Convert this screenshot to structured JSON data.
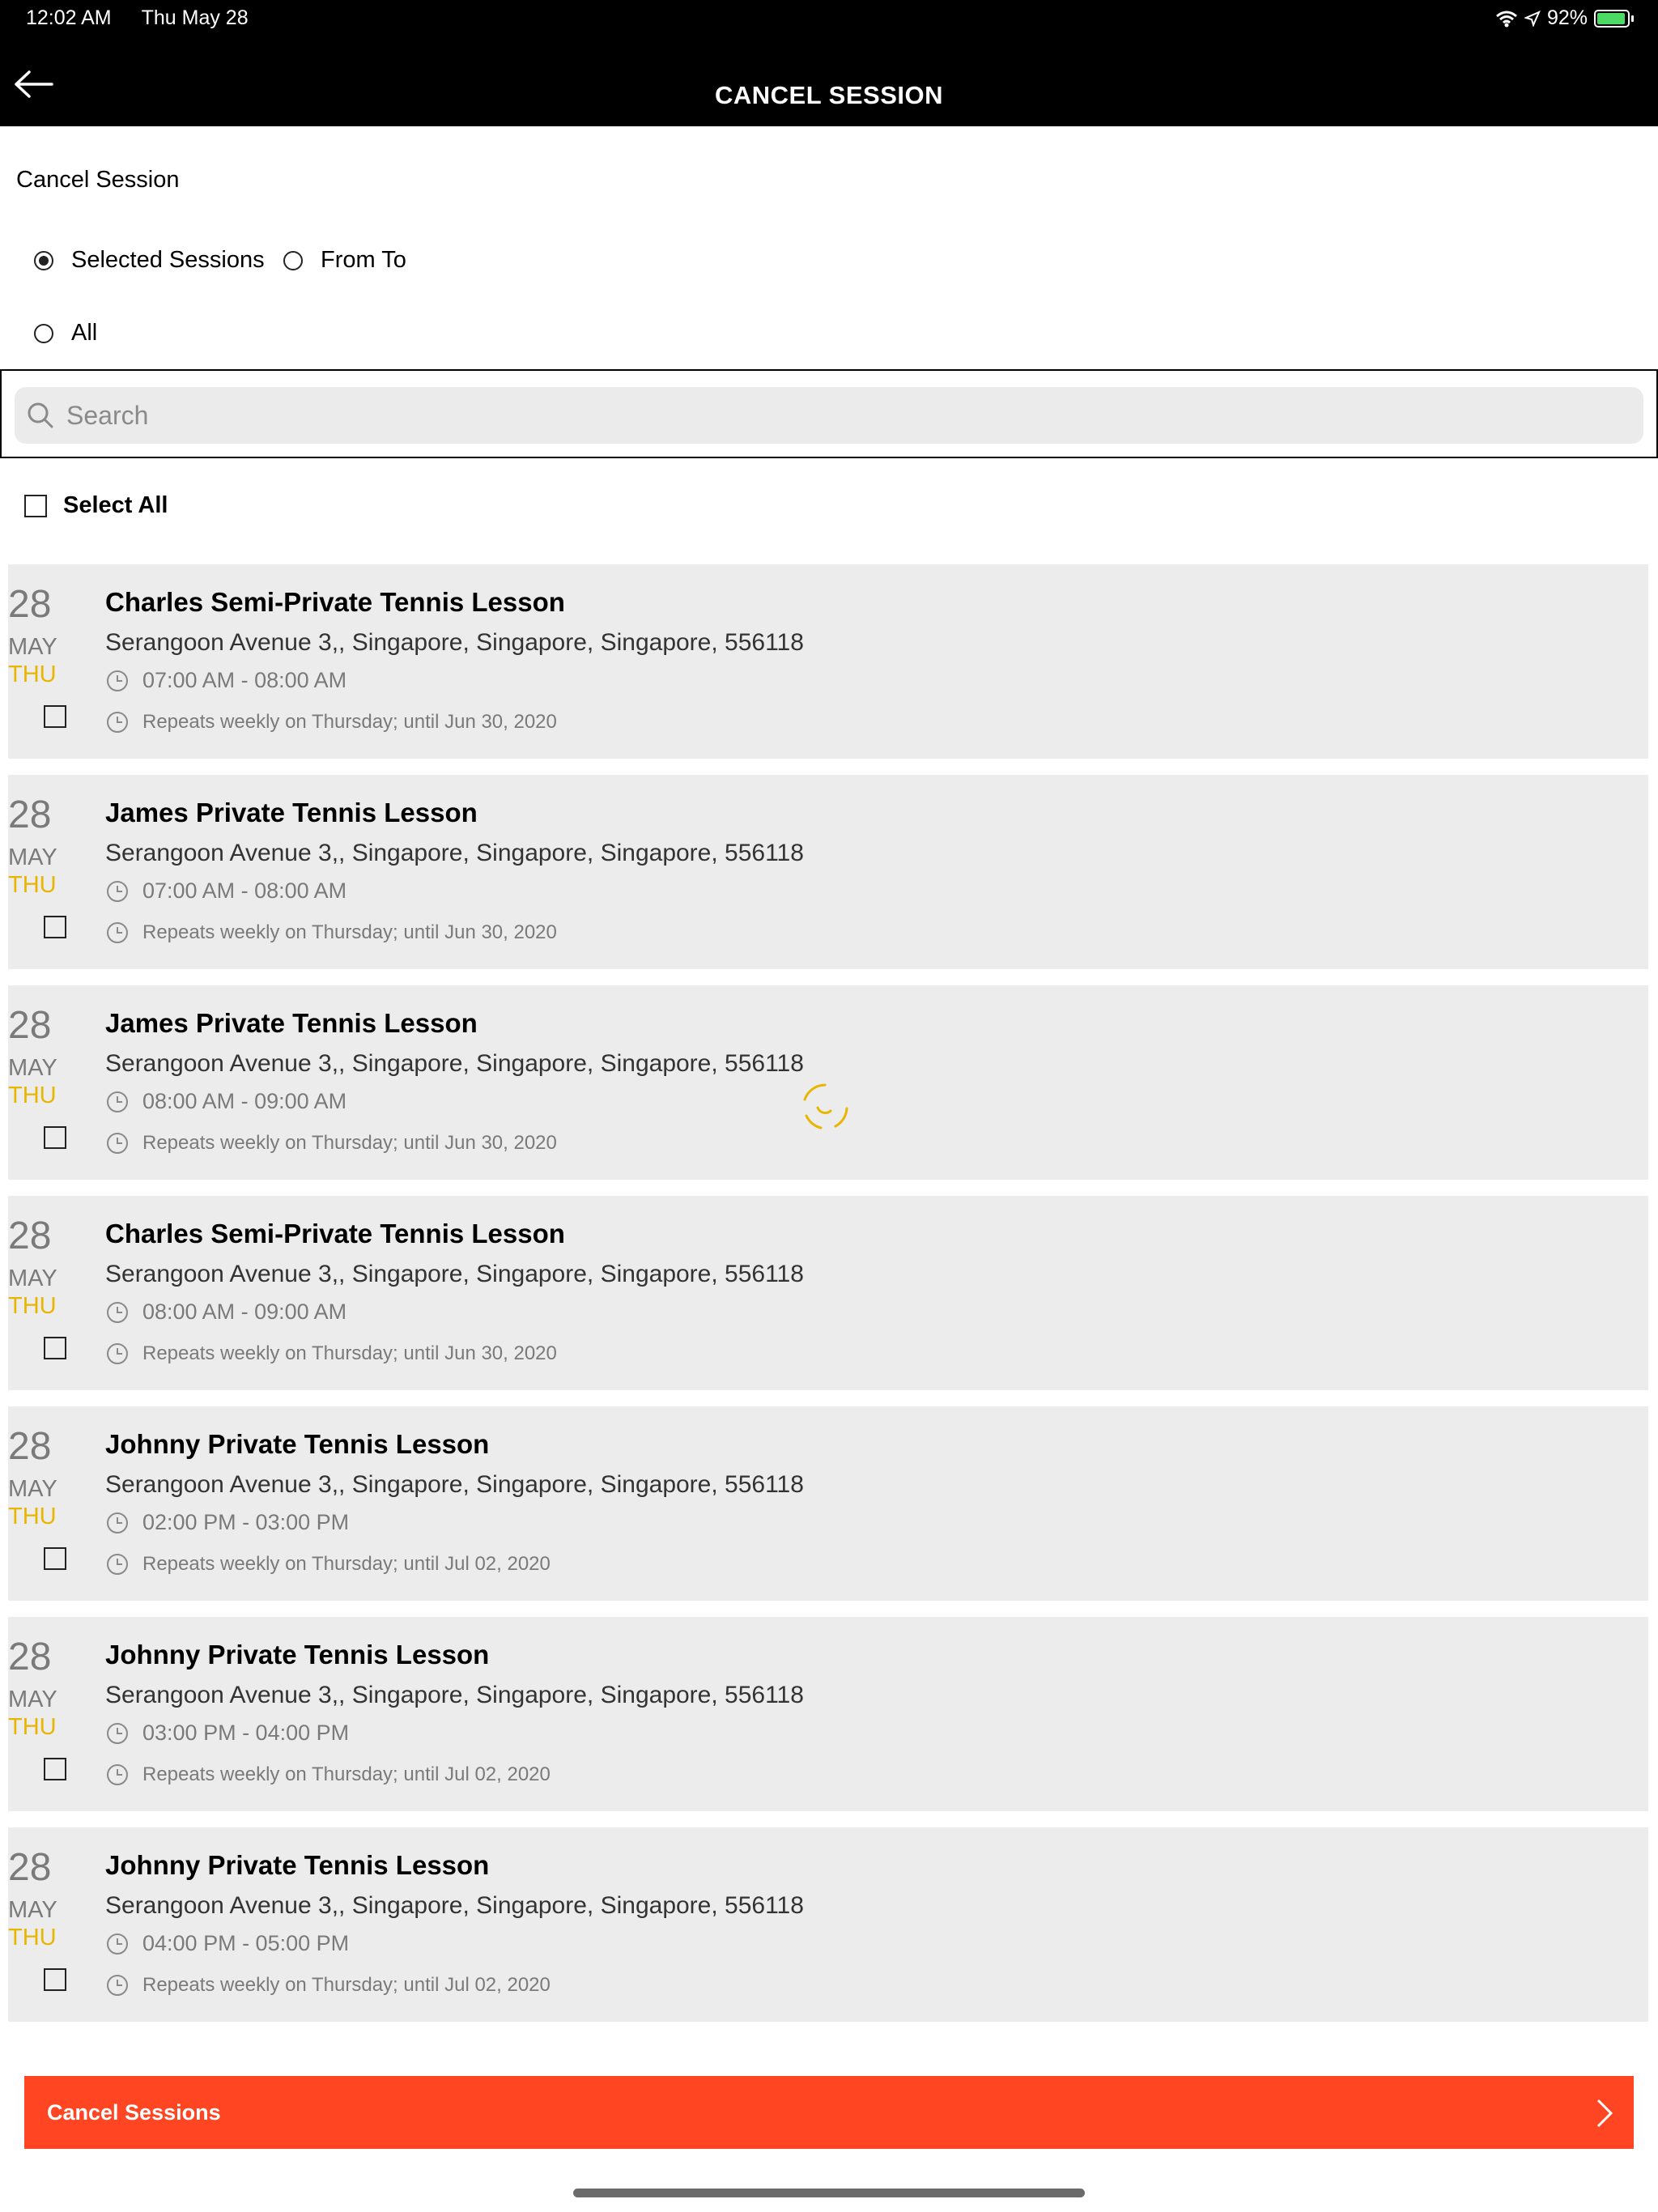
{
  "status_bar": {
    "time": "12:02 AM",
    "date": "Thu May 28",
    "battery": "92%"
  },
  "nav": {
    "title": "CANCEL SESSION",
    "back_icon": "back-arrow-icon"
  },
  "section_label": "Cancel Session",
  "options": {
    "selected_sessions": "Selected Sessions",
    "from_to": "From To",
    "all": "All",
    "selected": "selected_sessions"
  },
  "search": {
    "placeholder": "Search",
    "value": ""
  },
  "select_all_label": "Select All",
  "sessions": [
    {
      "day": "28",
      "month": "MAY",
      "weekday": "THU",
      "title": "Charles Semi-Private Tennis Lesson",
      "address": "Serangoon Avenue 3,, Singapore, Singapore, Singapore, 556118",
      "time": "07:00 AM - 08:00 AM",
      "repeat": "Repeats weekly on Thursday; until Jun 30, 2020"
    },
    {
      "day": "28",
      "month": "MAY",
      "weekday": "THU",
      "title": "James Private Tennis Lesson",
      "address": "Serangoon Avenue 3,, Singapore, Singapore, Singapore, 556118",
      "time": "07:00 AM - 08:00 AM",
      "repeat": "Repeats weekly on Thursday; until Jun 30, 2020"
    },
    {
      "day": "28",
      "month": "MAY",
      "weekday": "THU",
      "title": "James Private Tennis Lesson",
      "address": "Serangoon Avenue 3,, Singapore, Singapore, Singapore, 556118",
      "time": "08:00 AM - 09:00 AM",
      "repeat": "Repeats weekly on Thursday; until Jun 30, 2020"
    },
    {
      "day": "28",
      "month": "MAY",
      "weekday": "THU",
      "title": "Charles Semi-Private Tennis Lesson",
      "address": "Serangoon Avenue 3,, Singapore, Singapore, Singapore, 556118",
      "time": "08:00 AM - 09:00 AM",
      "repeat": "Repeats weekly on Thursday; until Jun 30, 2020"
    },
    {
      "day": "28",
      "month": "MAY",
      "weekday": "THU",
      "title": "Johnny Private Tennis Lesson",
      "address": "Serangoon Avenue 3,, Singapore, Singapore, Singapore, 556118",
      "time": "02:00 PM - 03:00 PM",
      "repeat": "Repeats weekly on Thursday; until Jul 02, 2020"
    },
    {
      "day": "28",
      "month": "MAY",
      "weekday": "THU",
      "title": "Johnny Private Tennis Lesson",
      "address": "Serangoon Avenue 3,, Singapore, Singapore, Singapore, 556118",
      "time": "03:00 PM - 04:00 PM",
      "repeat": "Repeats weekly on Thursday; until Jul 02, 2020"
    },
    {
      "day": "28",
      "month": "MAY",
      "weekday": "THU",
      "title": "Johnny Private Tennis Lesson",
      "address": "Serangoon Avenue 3,, Singapore, Singapore, Singapore, 556118",
      "time": "04:00 PM - 05:00 PM",
      "repeat": "Repeats weekly on Thursday; until Jul 02, 2020"
    }
  ],
  "cancel_button": {
    "label": "Cancel Sessions"
  },
  "colors": {
    "accent": "#ff4522",
    "weekday": "#e8b500",
    "spinner": "#e8b500",
    "card_bg": "#ececec",
    "header_bg": "#000000"
  }
}
